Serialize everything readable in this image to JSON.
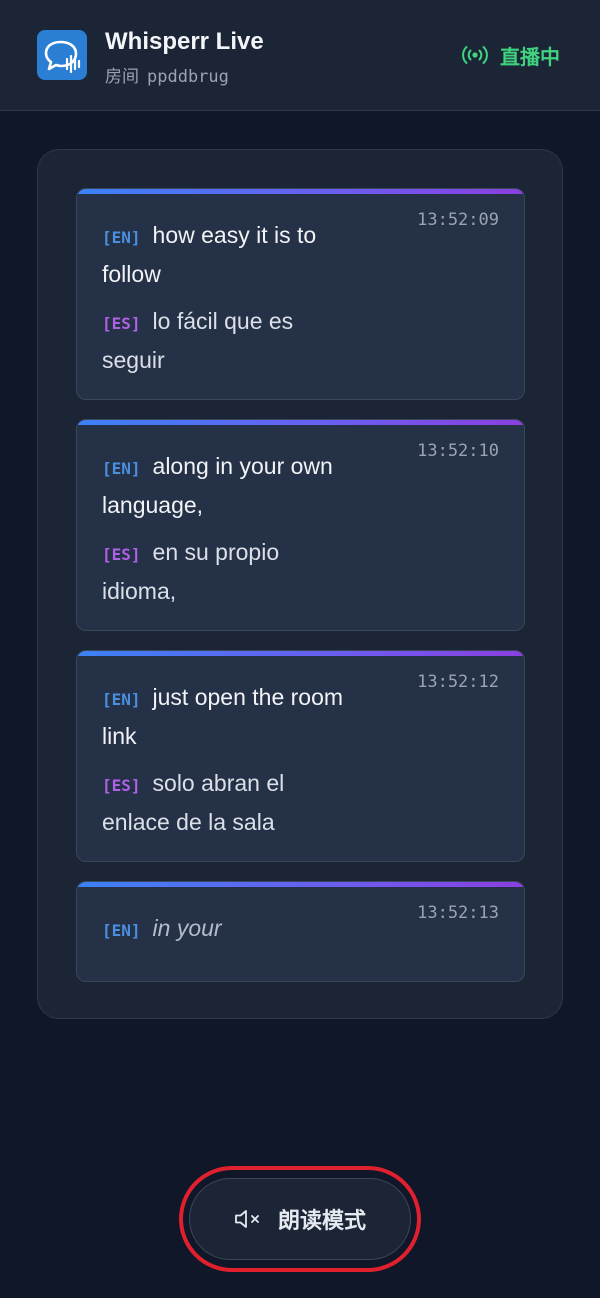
{
  "header": {
    "app_title": "Whisperr Live",
    "room_prefix": "房间",
    "room_id": "ppddbrug",
    "live_label": "直播中",
    "logo_icon": "chat-bubble-waveform-icon",
    "live_icon": "broadcast-icon"
  },
  "messages": [
    {
      "time": "13:52:09",
      "en_tag": "[EN]",
      "en_text": "how easy it is to follow",
      "es_tag": "[ES]",
      "es_text": "lo fácil que es seguir"
    },
    {
      "time": "13:52:10",
      "en_tag": "[EN]",
      "en_text": "along in your own language,",
      "es_tag": "[ES]",
      "es_text": "en su propio idioma,"
    },
    {
      "time": "13:52:12",
      "en_tag": "[EN]",
      "en_text": "just open the room link",
      "es_tag": "[ES]",
      "es_text": "solo abran el enlace de la sala"
    },
    {
      "time": "13:52:13",
      "en_tag": "[EN]",
      "en_text": "in your"
    }
  ],
  "read_aloud": {
    "label": "朗读模式",
    "icon": "speaker-muted-icon"
  },
  "colors": {
    "background": "#0f1729",
    "surface": "#1b2536",
    "card": "#253146",
    "live_green": "#3fd37f",
    "en_tag": "#4a90e2",
    "es_tag": "#b061e8",
    "highlight_ring": "#e0202d"
  }
}
